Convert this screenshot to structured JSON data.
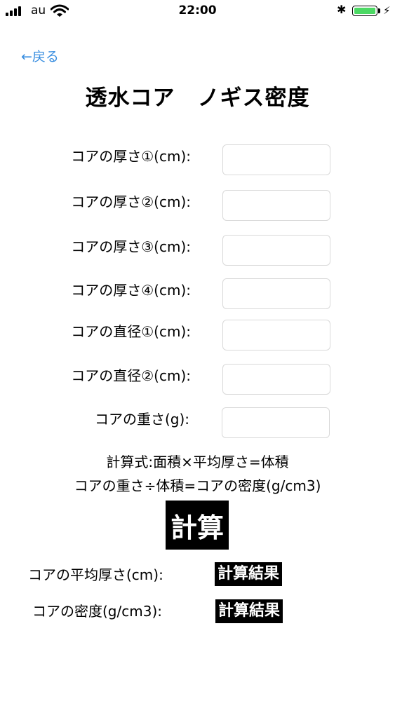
{
  "status_bar": {
    "carrier": "au",
    "time": "22:00",
    "battery_color": "#4cd964"
  },
  "nav": {
    "back_label": "←戻る",
    "back_color": "#3b8fe0"
  },
  "title": "透水コア　ノギス密度",
  "fields": [
    {
      "label": "コアの厚さ①(cm):",
      "value": ""
    },
    {
      "label": "コアの厚さ②(cm):",
      "value": ""
    },
    {
      "label": "コアの厚さ③(cm):",
      "value": ""
    },
    {
      "label": "コアの厚さ④(cm):",
      "value": ""
    },
    {
      "label": "コアの直径①(cm):",
      "value": ""
    },
    {
      "label": "コアの直径②(cm):",
      "value": ""
    },
    {
      "label": "コアの重さ(g):",
      "value": ""
    }
  ],
  "formula": {
    "line1": "計算式:面積×平均厚さ=体積",
    "line2": "コアの重さ÷体積=コアの密度(g/cm3)"
  },
  "calculate_label": "計算",
  "results": [
    {
      "label": "コアの平均厚さ(cm):",
      "value": "計算結果"
    },
    {
      "label": "コアの密度(g/cm3):",
      "value": "計算結果"
    }
  ]
}
